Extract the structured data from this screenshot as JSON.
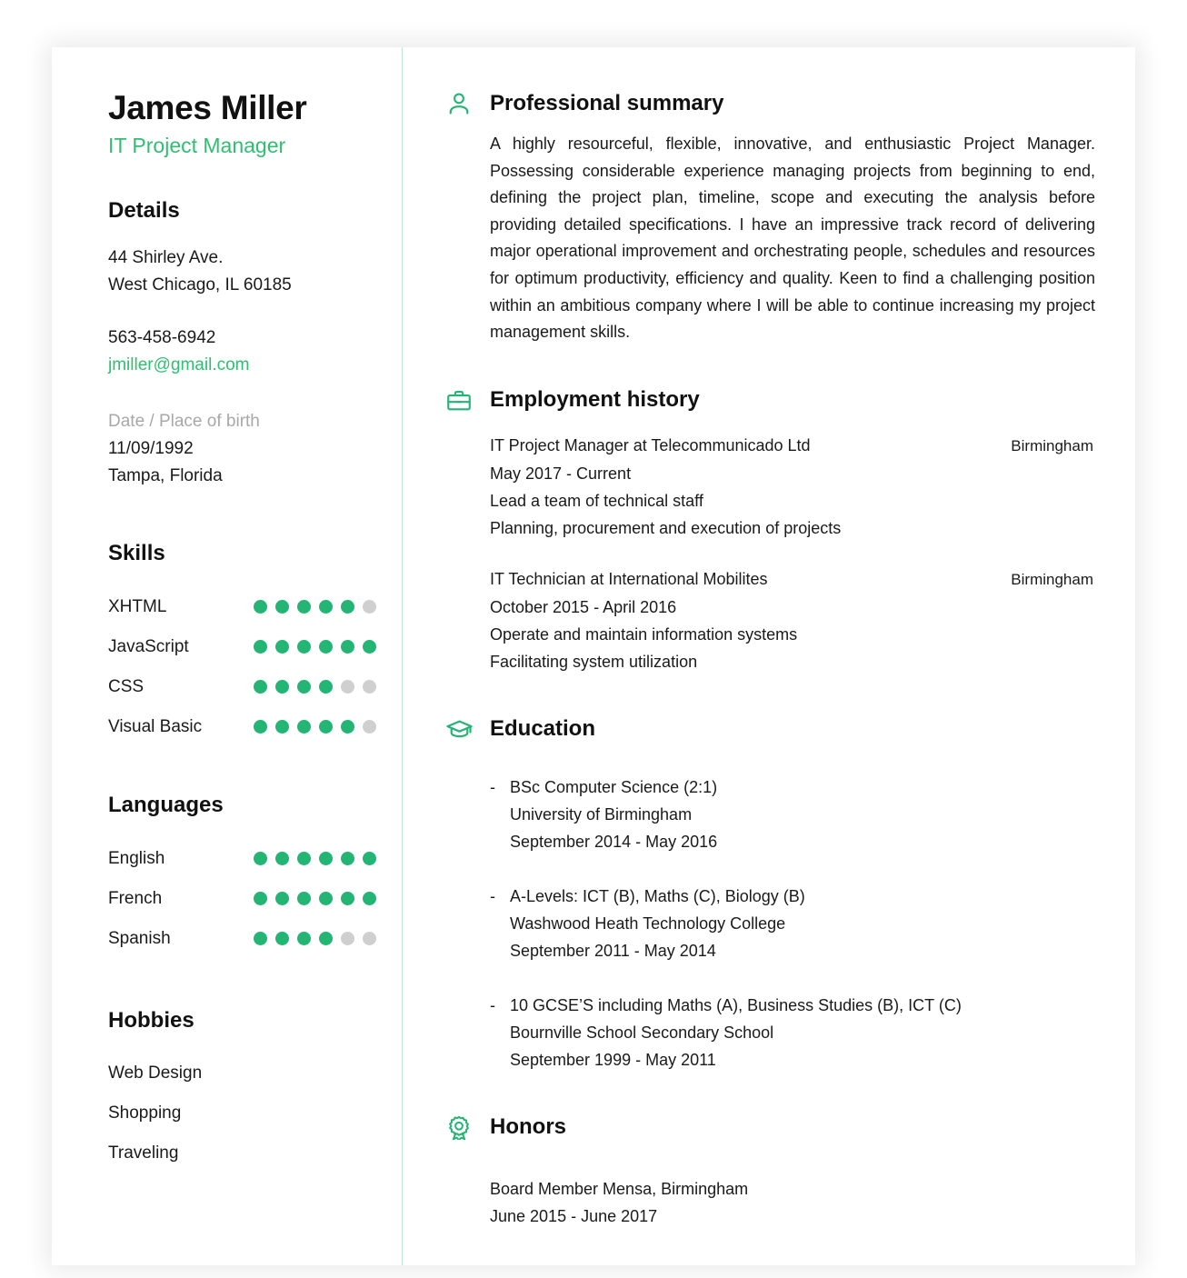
{
  "theme": {
    "accent_green": "#22b573",
    "title_green": "#2fbf71",
    "divider_green": "#bfe6d3",
    "dot_empty": "#cfcfcf",
    "text": "#1a1a1a",
    "muted_label": "#a8a8a8"
  },
  "header": {
    "full_name": "James Miller",
    "job_title": "IT Project Manager"
  },
  "details": {
    "heading": "Details",
    "address_line1": "44 Shirley Ave.",
    "address_line2": "West Chicago, IL 60185",
    "phone": "563-458-6942",
    "email": "jmiller@gmail.com",
    "birth_label": "Date / Place of birth",
    "birth_date": "11/09/1992",
    "birth_place": "Tampa, Florida"
  },
  "skills": {
    "heading": "Skills",
    "max": 6,
    "items": [
      {
        "label": "XHTML",
        "level": 5
      },
      {
        "label": "JavaScript",
        "level": 6
      },
      {
        "label": "CSS",
        "level": 4
      },
      {
        "label": "Visual Basic",
        "level": 5
      }
    ]
  },
  "languages": {
    "heading": "Languages",
    "max": 6,
    "items": [
      {
        "label": "English",
        "level": 6
      },
      {
        "label": "French",
        "level": 6
      },
      {
        "label": "Spanish",
        "level": 4
      }
    ]
  },
  "hobbies": {
    "heading": "Hobbies",
    "items": [
      "Web Design",
      "Shopping",
      "Traveling"
    ]
  },
  "professional_summary": {
    "title": "Professional summary",
    "icon": "person-icon",
    "text": "A highly resourceful, flexible, innovative, and enthusiastic Project Manager. Possessing considerable experience managing projects from beginning to end, defining the project plan, timeline, scope and executing the analysis before providing detailed specifications. I have an impressive track record of delivering major operational improvement and orchestrating people, schedules and resources for optimum productivity, efficiency and quality. Keen to find a challenging position within an ambitious company where I will be able to continue increasing my project management skills."
  },
  "employment_history": {
    "title": "Employment history",
    "icon": "briefcase-icon",
    "jobs": [
      {
        "role": "IT Project Manager at Telecommunicado Ltd",
        "location": "Birmingham",
        "dates": "May 2017 - Current",
        "bullets": [
          "Lead a team of technical staff",
          "Planning, procurement and execution of projects"
        ]
      },
      {
        "role": "IT Technician at International Mobilites",
        "location": "Birmingham",
        "dates": "October 2015 - April 2016",
        "bullets": [
          "Operate and maintain information systems",
          "Facilitating system utilization"
        ]
      }
    ]
  },
  "education": {
    "title": "Education",
    "icon": "graduation-cap-icon",
    "bullet_char": "-",
    "entries": [
      {
        "qualification": "BSc Computer Science (2:1)",
        "institution": "University of Birmingham",
        "dates": "September 2014 - May 2016"
      },
      {
        "qualification": "A-Levels: ICT (B), Maths (C), Biology (B)",
        "institution": "Washwood Heath Technology College",
        "dates": "September 2011 - May 2014"
      },
      {
        "qualification": "10 GCSE’S including Maths (A), Business Studies (B), ICT (C)",
        "institution": "Bournville School Secondary School",
        "dates": "September 1999 - May 2011"
      }
    ]
  },
  "honors": {
    "title": "Honors",
    "icon": "award-ribbon-icon",
    "entries": [
      {
        "description": "Board Member Mensa, Birmingham",
        "dates": "June 2015 - June 2017"
      }
    ]
  }
}
